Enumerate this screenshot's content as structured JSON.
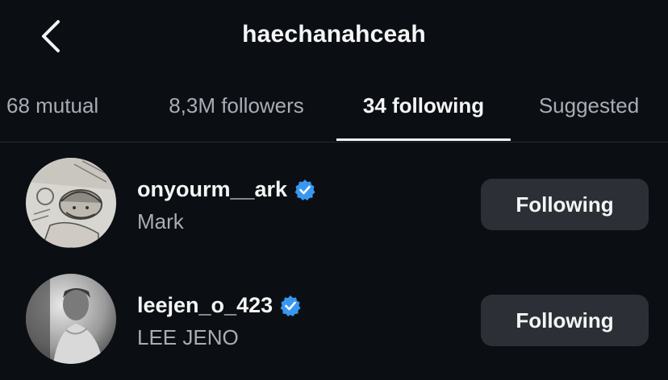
{
  "header": {
    "title": "haechanahceah",
    "back_icon": "chevron-left-icon"
  },
  "tabs": [
    {
      "label": "68 mutual",
      "active": false
    },
    {
      "label": "8,3M followers",
      "active": false
    },
    {
      "label": "34 following",
      "active": true
    },
    {
      "label": "Suggested",
      "active": false
    }
  ],
  "accounts": [
    {
      "username": "onyourm__ark",
      "name": "Mark",
      "verified": true,
      "button_label": "Following"
    },
    {
      "username": "leejen_o_423",
      "name": "LEE JENO",
      "verified": true,
      "button_label": "Following"
    }
  ],
  "colors": {
    "background": "#0b0f14",
    "verified_badge": "#3897f0",
    "button_bg": "#2c3036",
    "secondary_text": "#a8adb5"
  }
}
